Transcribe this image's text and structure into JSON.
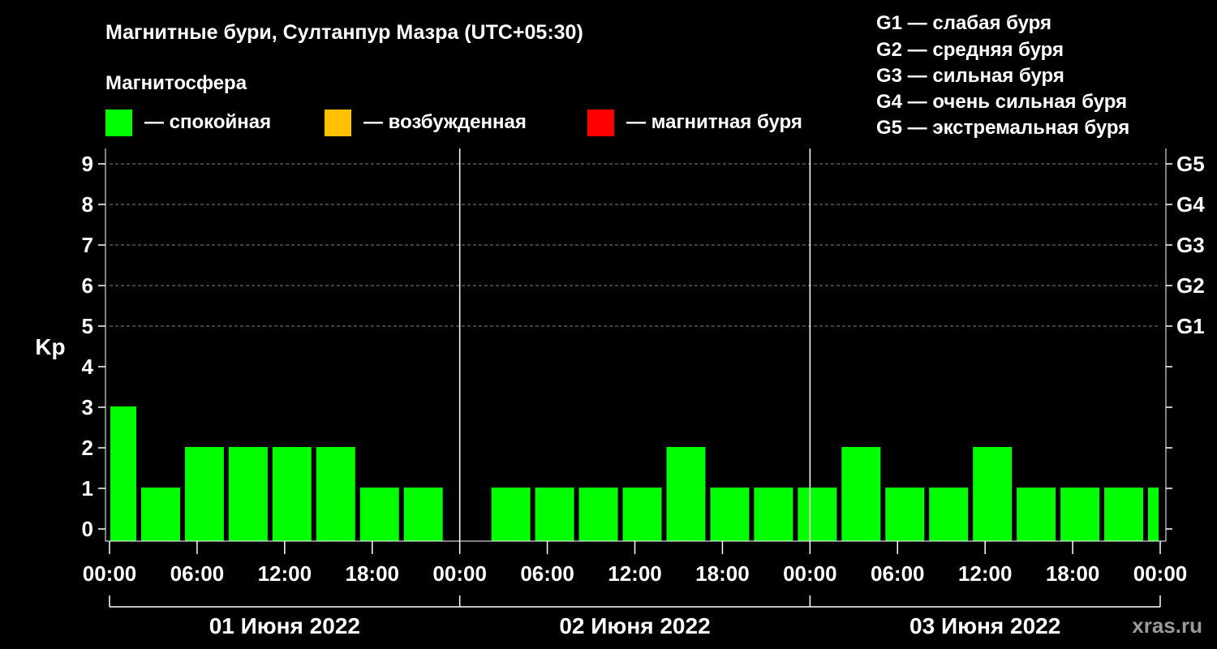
{
  "chart_data": {
    "type": "bar",
    "title": "Магнитные бури, Султанпур Мазра (UTC+05:30)",
    "legend": {
      "title": "Магнитосфера",
      "items": [
        {
          "label": "— спокойная",
          "color": "#00ff00"
        },
        {
          "label": "— возбужденная",
          "color": "#ffc000"
        },
        {
          "label": "— магнитная буря",
          "color": "#ff0000"
        }
      ]
    },
    "g_scale": [
      "G1 — слабая буря",
      "G2 — средняя буря",
      "G3 — сильная буря",
      "G4 — очень сильная буря",
      "G5 — экстремальная буря"
    ],
    "ylabel": "Kp",
    "ylim": [
      0,
      9
    ],
    "yticks": [
      "0",
      "1",
      "2",
      "3",
      "4",
      "5",
      "6",
      "7",
      "8",
      "9"
    ],
    "right_ticks": [
      {
        "level": 5,
        "label": "G1"
      },
      {
        "level": 6,
        "label": "G2"
      },
      {
        "level": 7,
        "label": "G3"
      },
      {
        "level": 8,
        "label": "G4"
      },
      {
        "level": 9,
        "label": "G5"
      }
    ],
    "grid": "dashed horizontal",
    "x_tick_labels": [
      "00:00",
      "06:00",
      "12:00",
      "18:00",
      "00:00",
      "06:00",
      "12:00",
      "18:00",
      "00:00",
      "06:00",
      "12:00",
      "18:00",
      "00:00"
    ],
    "days": [
      "01 Июня 2022",
      "02 Июня 2022",
      "03 Июня 2022"
    ],
    "bar_hours": [
      0.5,
      3.5,
      6.5,
      9.5,
      12.5,
      15.5,
      18.5,
      21.5,
      24.5,
      27.5,
      30.5,
      33.5,
      36.5,
      39.5,
      42.5,
      45.5,
      48.5,
      51.5,
      54.5,
      57.5,
      60.5,
      63.5,
      66.5,
      69.5,
      72.5
    ],
    "values": [
      3,
      1,
      2,
      2,
      2,
      2,
      1,
      1,
      0,
      1,
      1,
      1,
      1,
      2,
      1,
      1,
      1,
      2,
      1,
      1,
      2,
      1,
      1,
      1,
      1
    ],
    "bar_colors": [
      "#00ff00"
    ]
  },
  "watermark": "xras.ru"
}
